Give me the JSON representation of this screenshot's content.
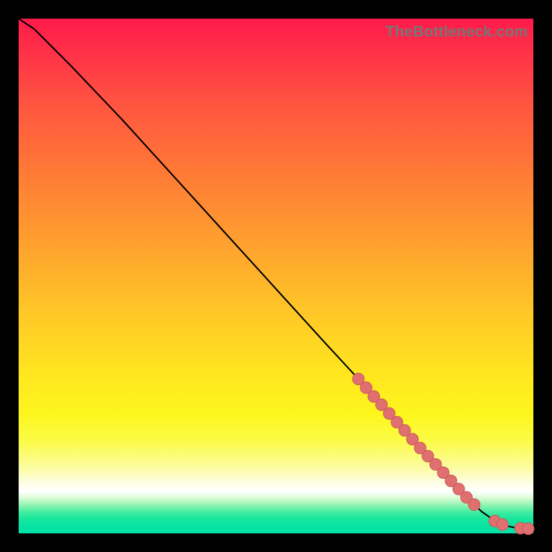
{
  "watermark": "TheBottleneck.com",
  "chart_data": {
    "type": "line",
    "title": "",
    "xlabel": "",
    "ylabel": "",
    "xlim": [
      0,
      100
    ],
    "ylim": [
      0,
      100
    ],
    "grid": false,
    "legend": false,
    "curve": {
      "x": [
        0,
        3,
        6,
        10,
        20,
        30,
        40,
        50,
        60,
        66,
        70,
        75,
        80,
        85,
        88,
        90,
        92,
        93.5,
        95,
        97,
        98.5,
        100
      ],
      "y": [
        100,
        98,
        95,
        91,
        80.5,
        69.5,
        58.5,
        47.5,
        36.5,
        30,
        25.5,
        20,
        14.5,
        9,
        6,
        4.2,
        2.8,
        2.0,
        1.4,
        1.0,
        0.95,
        0.9
      ]
    },
    "markers": {
      "note": "highlighted points along the lower segment of the curve",
      "x": [
        66,
        67.5,
        69,
        70.5,
        72,
        73.5,
        75,
        76.5,
        78,
        79.5,
        81,
        82.5,
        84,
        85.5,
        87,
        88.5,
        92.5,
        94,
        97.5,
        99
      ],
      "y": [
        30,
        28.3,
        26.6,
        25,
        23.3,
        21.6,
        20,
        18.3,
        16.6,
        15,
        13.4,
        11.8,
        10.2,
        8.6,
        7.0,
        5.6,
        2.4,
        1.7,
        1.0,
        0.9
      ]
    },
    "colors": {
      "gradient_top": "#ff1a4b",
      "gradient_mid": "#ffe61f",
      "gradient_bottom": "#02e1a8",
      "curve": "#000000",
      "marker_fill": "#e07070",
      "background_border": "#000000"
    }
  }
}
